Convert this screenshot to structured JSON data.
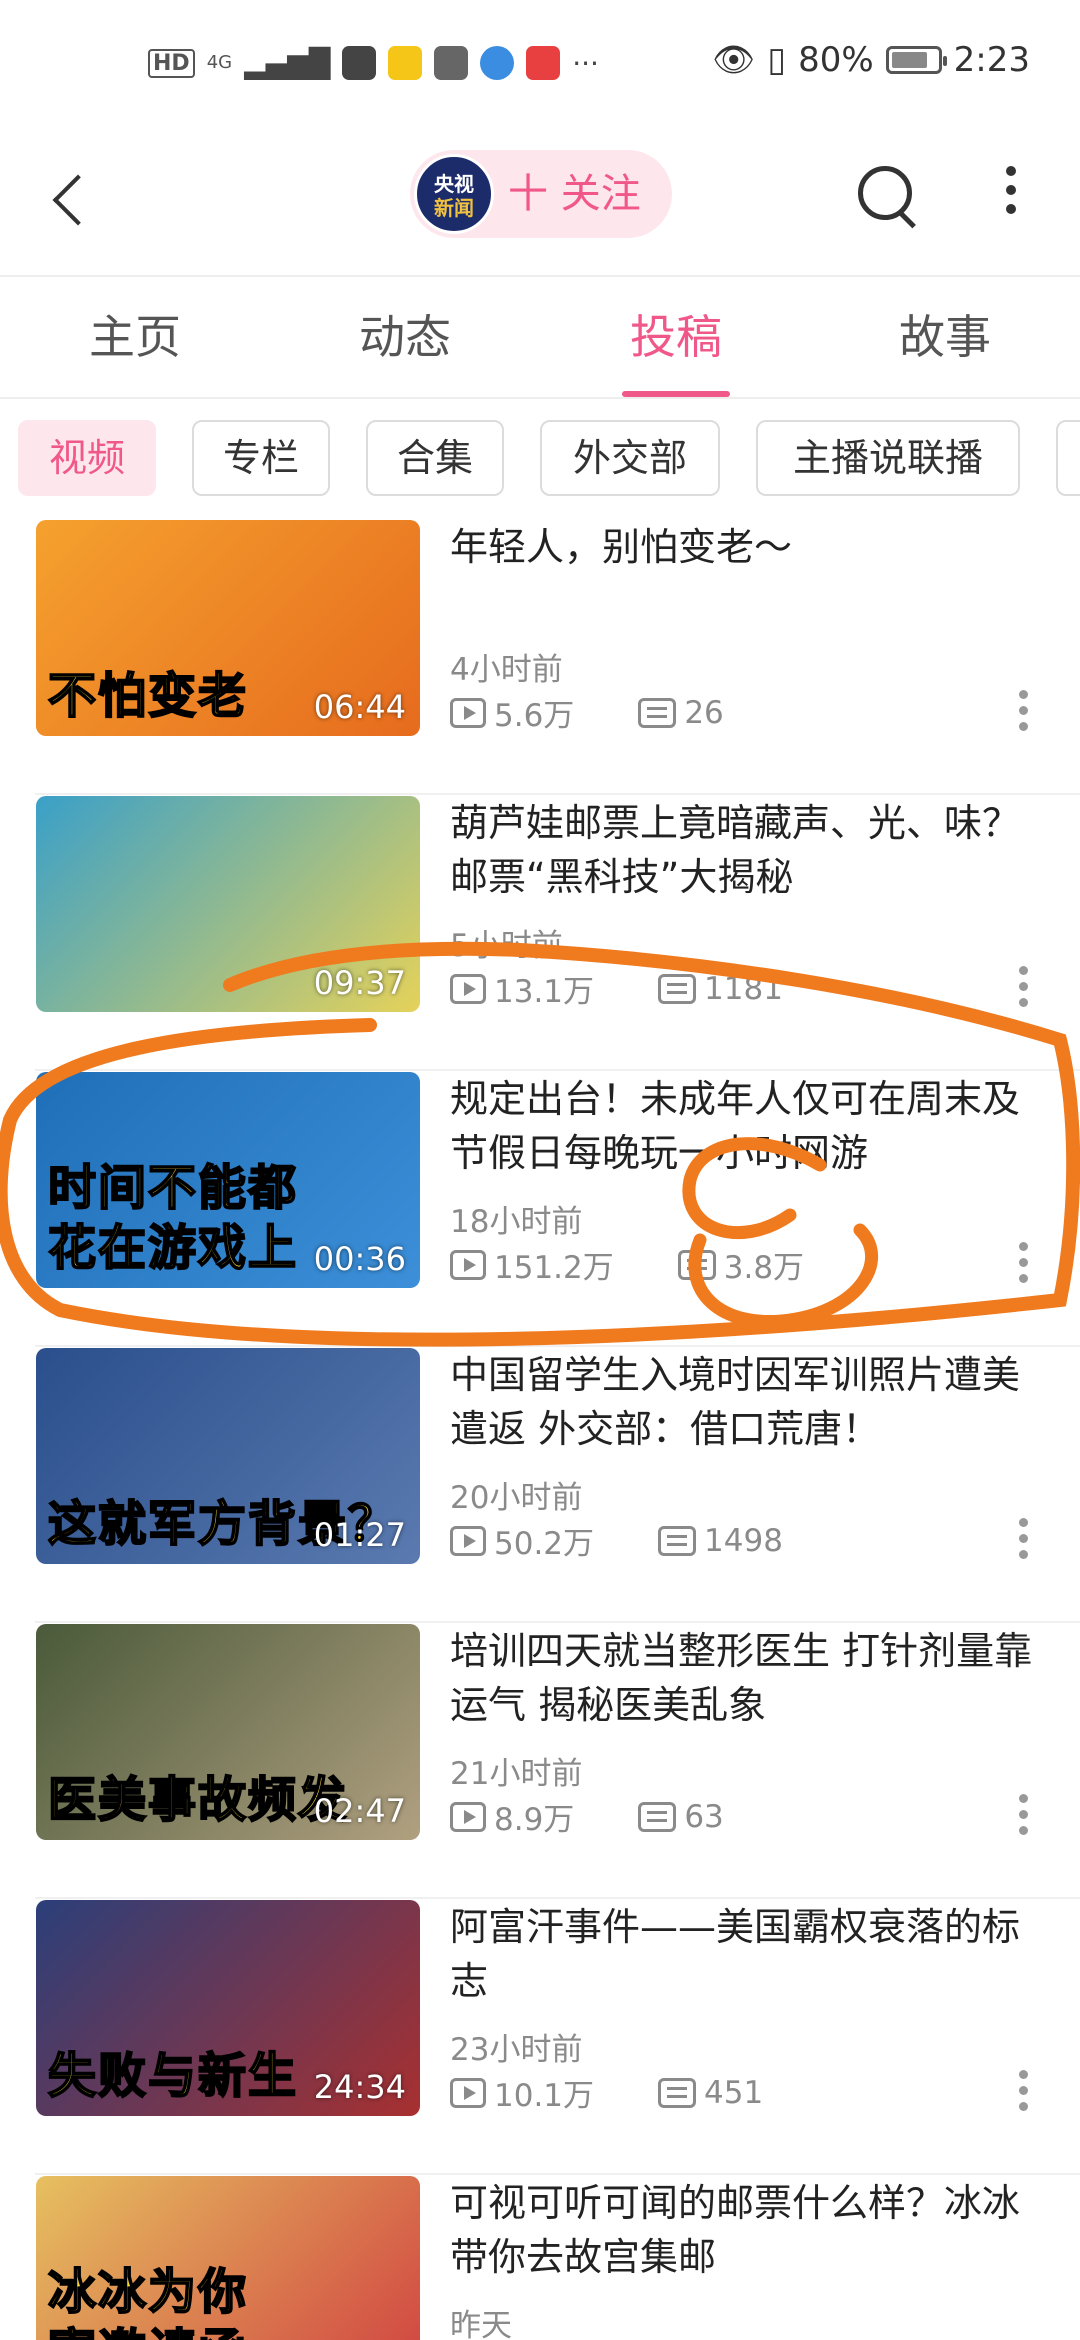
{
  "status_bar": {
    "hd": "HD",
    "network": "4G",
    "battery_percent": "80%",
    "battery_level": 0.8,
    "time": "2:23"
  },
  "header": {
    "account_logo_line1": "央视",
    "account_logo_line2": "新闻",
    "follow_label": "十 关注",
    "icons": [
      "back-icon",
      "search-icon",
      "more-vertical-icon"
    ]
  },
  "tabs": [
    {
      "label": "主页",
      "active": false
    },
    {
      "label": "动态",
      "active": false
    },
    {
      "label": "投稿",
      "active": true
    },
    {
      "label": "故事",
      "active": false
    }
  ],
  "chips": [
    {
      "label": "视频",
      "active": true
    },
    {
      "label": "专栏",
      "active": false
    },
    {
      "label": "合集",
      "active": false
    },
    {
      "label": "外交部",
      "active": false
    },
    {
      "label": "主播说联播",
      "active": false
    }
  ],
  "videos": [
    {
      "title": "年轻人，别怕变老～",
      "time": "4小时前",
      "views": "5.6万",
      "comments": "26",
      "duration": "06:44",
      "caption": "不怕变老",
      "thumb_colors": [
        "#f5a12e",
        "#e66b1e"
      ]
    },
    {
      "title": "葫芦娃邮票上竟暗藏声、光、味？邮票“黑科技”大揭秘",
      "time": "5小时前",
      "views": "13.1万",
      "comments": "1181",
      "duration": "09:37",
      "caption": "",
      "thumb_colors": [
        "#3aa0c8",
        "#e5d25a"
      ]
    },
    {
      "title": "规定出台！未成年人仅可在周末及节假日每晚玩一小时网游",
      "time": "18小时前",
      "views": "151.2万",
      "comments": "3.8万",
      "duration": "00:36",
      "caption": "时间不能都\n花在游戏上",
      "thumb_colors": [
        "#1f6fb8",
        "#3c8fd8"
      ]
    },
    {
      "title": "中国留学生入境时因军训照片遭美遣返 外交部：借口荒唐！",
      "time": "20小时前",
      "views": "50.2万",
      "comments": "1498",
      "duration": "01:27",
      "caption": "这就军方背景？",
      "thumb_colors": [
        "#2a4f8c",
        "#5a7ab0"
      ]
    },
    {
      "title": "培训四天就当整形医生 打针剂量靠运气 揭秘医美乱象",
      "time": "21小时前",
      "views": "8.9万",
      "comments": "63",
      "duration": "02:47",
      "caption": "医美事故频发",
      "thumb_colors": [
        "#4a5a3a",
        "#b0a080"
      ]
    },
    {
      "title": "阿富汗事件——美国霸权衰落的标志",
      "time": "23小时前",
      "views": "10.1万",
      "comments": "451",
      "duration": "24:34",
      "caption": "失败与新生",
      "thumb_colors": [
        "#2b3f7a",
        "#a83030"
      ]
    },
    {
      "title": "可视可听可闻的邮票什么样？冰冰带你去故宫集邮",
      "time": "昨天",
      "views": "",
      "comments": "",
      "duration": "",
      "caption": "冰冰为你\n寄邀请函",
      "thumb_colors": [
        "#e6c060",
        "#d04040"
      ]
    }
  ],
  "colors": {
    "accent": "#f0588a",
    "accent_bg": "#fde6ec",
    "annotation": "#f07a1e"
  }
}
